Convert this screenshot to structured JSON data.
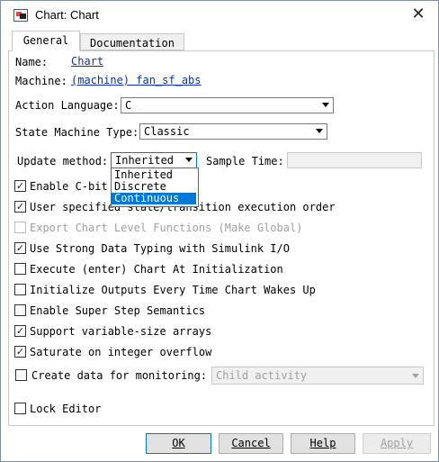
{
  "window": {
    "title": "Chart: Chart"
  },
  "tabs": [
    {
      "label": "General"
    },
    {
      "label": "Documentation"
    }
  ],
  "general": {
    "name_label": "Name:",
    "name_value": "Chart",
    "machine_label": "Machine:",
    "machine_value": "(machine) fan_sf_abs",
    "action_language_label": "Action Language:",
    "action_language_value": "C",
    "state_machine_type_label": "State Machine Type:",
    "state_machine_type_value": "Classic",
    "update_method_label": "Update method:",
    "update_method_value": "Inherited",
    "update_method_options": [
      "Inherited",
      "Discrete",
      "Continuous"
    ],
    "update_method_highlighted": "Continuous",
    "sample_time_label": "Sample Time:",
    "sample_time_value": ""
  },
  "checkboxes": [
    {
      "label": "Enable C-bit",
      "checked": true,
      "disabled": false
    },
    {
      "label": "User specified state/transition execution order",
      "checked": true,
      "disabled": false
    },
    {
      "label": "Export Chart Level Functions (Make Global)",
      "checked": false,
      "disabled": true
    },
    {
      "label": "Use Strong Data Typing with Simulink I/O",
      "checked": true,
      "disabled": false
    },
    {
      "label": "Execute (enter) Chart At Initialization",
      "checked": false,
      "disabled": false
    },
    {
      "label": "Initialize Outputs Every Time Chart Wakes Up",
      "checked": false,
      "disabled": false
    },
    {
      "label": "Enable Super Step Semantics",
      "checked": false,
      "disabled": false
    },
    {
      "label": "Support variable-size arrays",
      "checked": true,
      "disabled": false
    },
    {
      "label": "Saturate on integer overflow",
      "checked": true,
      "disabled": false
    }
  ],
  "monitoring": {
    "label": "Create data for monitoring:",
    "checked": false,
    "value": "Child activity"
  },
  "lock_editor": {
    "label": "Lock Editor",
    "checked": false
  },
  "buttons": {
    "ok": "OK",
    "cancel": "Cancel",
    "help": "Help",
    "apply": "Apply"
  },
  "colors": {
    "link": "#0b31a8",
    "selection": "#0078d7",
    "disabled_text": "#a0a0a0"
  },
  "icons": {
    "app": "simulink-chart-icon",
    "close": "close-icon",
    "check": "checkmark"
  }
}
